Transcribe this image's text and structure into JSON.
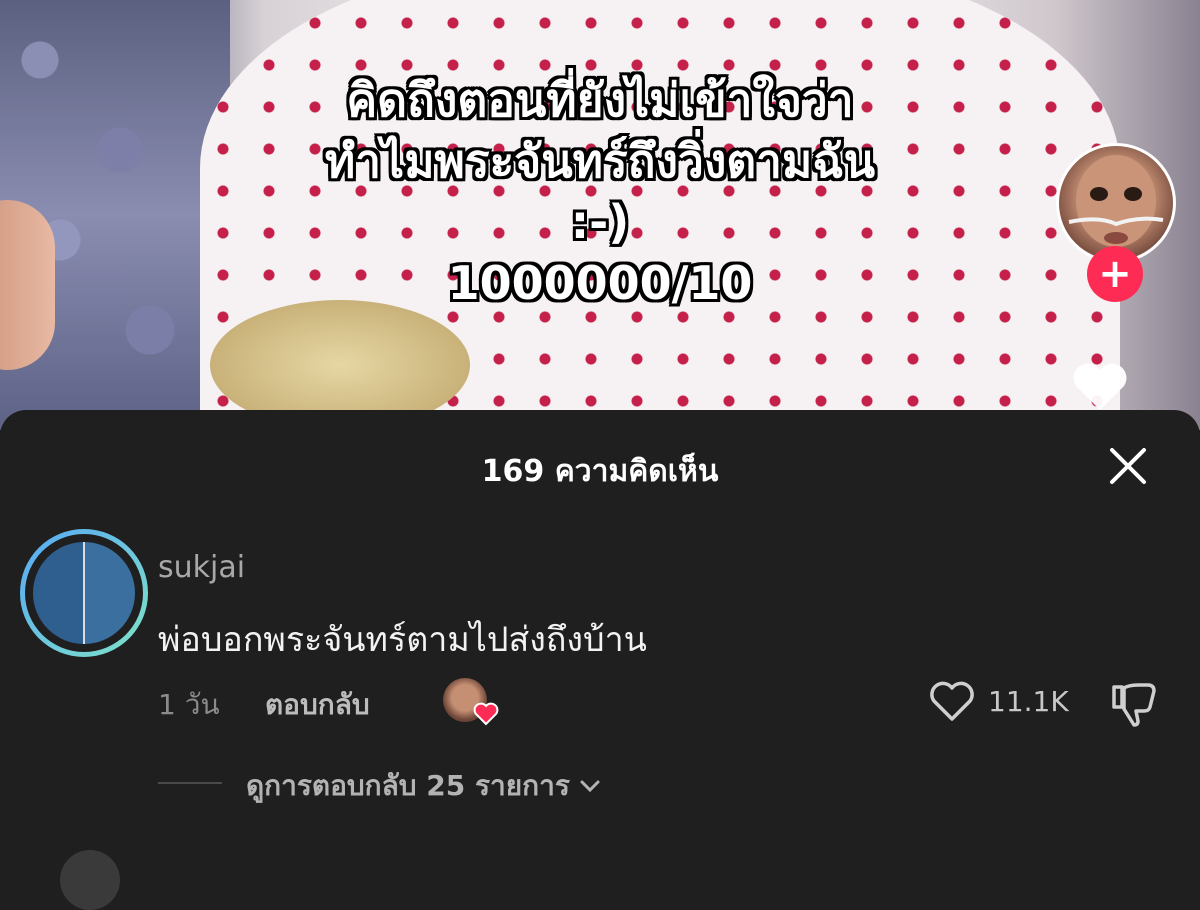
{
  "video": {
    "caption_lines": [
      "คิดถึงตอนที่ยังไม่เข้าใจว่า",
      "ทำไมพระจันทร์ถึงวิ่งตามฉัน",
      ":-)",
      "1000000/10"
    ],
    "follow_symbol": "+"
  },
  "sheet": {
    "title": "169 ความคิดเห็น"
  },
  "comment": {
    "username": "sukjai",
    "text": "พ่อบอกพระจันทร์ตามไปส่งถึงบ้าน",
    "time": "1 วัน",
    "reply_label": "ตอบกลับ",
    "like_count": "11.1K",
    "view_replies_label": "ดูการตอบกลับ 25 รายการ"
  },
  "icons": {
    "close": "close-icon",
    "like": "heart-outline-icon",
    "dislike": "thumbs-down-icon",
    "chevron": "chevron-down-icon",
    "creator_heart": "heart-filled-icon"
  },
  "colors": {
    "sheet_bg": "#1f1f1f",
    "accent": "#fe2c55",
    "avatar_ring_start": "#57a8f5",
    "avatar_ring_end": "#7fe3c8"
  }
}
